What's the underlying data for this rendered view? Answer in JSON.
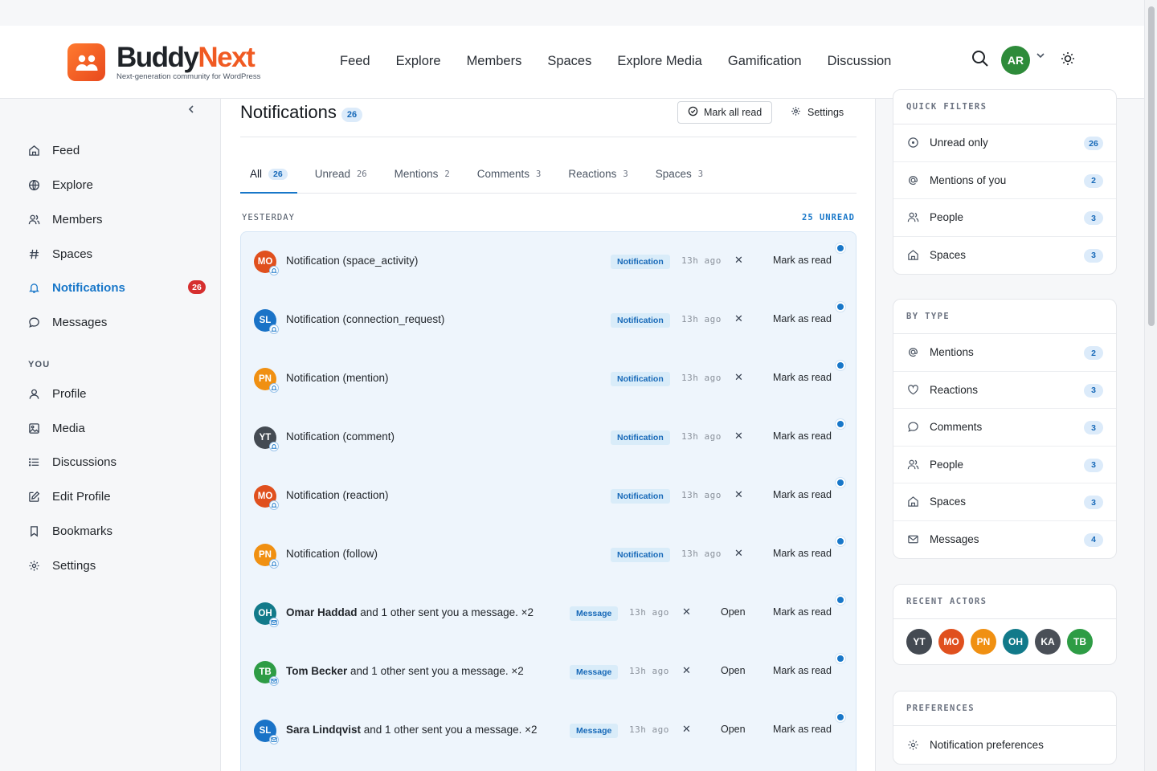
{
  "brand": {
    "name_part1": "Buddy",
    "name_part2": "Next",
    "tagline": "Next-generation community for WordPress"
  },
  "topnav": [
    "Feed",
    "Explore",
    "Members",
    "Spaces",
    "Explore Media",
    "Gamification",
    "Discussion"
  ],
  "user": {
    "initials": "AR"
  },
  "sidebar": {
    "main": [
      {
        "label": "Feed",
        "icon": "home-icon"
      },
      {
        "label": "Explore",
        "icon": "globe-icon"
      },
      {
        "label": "Members",
        "icon": "users-icon"
      },
      {
        "label": "Spaces",
        "icon": "hash-icon"
      },
      {
        "label": "Notifications",
        "icon": "bell-icon",
        "badge": "26",
        "active": true
      },
      {
        "label": "Messages",
        "icon": "chat-icon"
      }
    ],
    "you_heading": "YOU",
    "you": [
      {
        "label": "Profile",
        "icon": "user-icon"
      },
      {
        "label": "Media",
        "icon": "image-icon"
      },
      {
        "label": "Discussions",
        "icon": "list-icon"
      },
      {
        "label": "Edit Profile",
        "icon": "edit-icon"
      },
      {
        "label": "Bookmarks",
        "icon": "bookmark-icon"
      },
      {
        "label": "Settings",
        "icon": "gear-icon"
      }
    ]
  },
  "page": {
    "title": "Notifications",
    "count": "26",
    "mark_all_label": "Mark all read",
    "settings_label": "Settings",
    "tabs": [
      {
        "label": "All",
        "count": "26",
        "active": true
      },
      {
        "label": "Unread",
        "count": "26"
      },
      {
        "label": "Mentions",
        "count": "2"
      },
      {
        "label": "Comments",
        "count": "3"
      },
      {
        "label": "Reactions",
        "count": "3"
      },
      {
        "label": "Spaces",
        "count": "3"
      }
    ],
    "group_label": "YESTERDAY",
    "group_unread": "25 UNREAD",
    "colors": {
      "accent": "#1877c9",
      "badge_red": "#d62f2f"
    }
  },
  "notifications": [
    {
      "initials": "MO",
      "color": "#e0501e",
      "actor": "",
      "text": "Notification (space_activity)",
      "type": "Notification",
      "time": "13h ago",
      "open": "",
      "mark": "Mark as read",
      "mini": "bell"
    },
    {
      "initials": "SL",
      "color": "#1a73c7",
      "actor": "",
      "text": "Notification (connection_request)",
      "type": "Notification",
      "time": "13h ago",
      "open": "",
      "mark": "Mark as read",
      "mini": "bell"
    },
    {
      "initials": "PN",
      "color": "#f09012",
      "actor": "",
      "text": "Notification (mention)",
      "type": "Notification",
      "time": "13h ago",
      "open": "",
      "mark": "Mark as read",
      "mini": "bell"
    },
    {
      "initials": "YT",
      "color": "#444a52",
      "actor": "",
      "text": "Notification (comment)",
      "type": "Notification",
      "time": "13h ago",
      "open": "",
      "mark": "Mark as read",
      "mini": "bell"
    },
    {
      "initials": "MO",
      "color": "#e0501e",
      "actor": "",
      "text": "Notification (reaction)",
      "type": "Notification",
      "time": "13h ago",
      "open": "",
      "mark": "Mark as read",
      "mini": "bell"
    },
    {
      "initials": "PN",
      "color": "#f09012",
      "actor": "",
      "text": "Notification (follow)",
      "type": "Notification",
      "time": "13h ago",
      "open": "",
      "mark": "Mark as read",
      "mini": "bell"
    },
    {
      "initials": "OH",
      "color": "#127a8a",
      "actor": "Omar Haddad",
      "text": " and 1 other sent you a message. ×2",
      "type": "Message",
      "time": "13h ago",
      "open": "Open",
      "mark": "Mark as read",
      "mini": "mail"
    },
    {
      "initials": "TB",
      "color": "#2e9c45",
      "actor": "Tom Becker",
      "text": " and 1 other sent you a message. ×2",
      "type": "Message",
      "time": "13h ago",
      "open": "Open",
      "mark": "Mark as read",
      "mini": "mail"
    },
    {
      "initials": "SL",
      "color": "#1a73c7",
      "actor": "Sara Lindqvist",
      "text": " and 1 other sent you a message. ×2",
      "type": "Message",
      "time": "13h ago",
      "open": "Open",
      "mark": "Mark as read",
      "mini": "mail"
    }
  ],
  "quick_filters": {
    "title": "QUICK FILTERS",
    "items": [
      {
        "label": "Unread only",
        "count": "26",
        "icon": "circle-icon"
      },
      {
        "label": "Mentions of you",
        "count": "2",
        "icon": "at-icon"
      },
      {
        "label": "People",
        "count": "3",
        "icon": "users-icon"
      },
      {
        "label": "Spaces",
        "count": "3",
        "icon": "home-icon"
      }
    ]
  },
  "by_type": {
    "title": "BY TYPE",
    "items": [
      {
        "label": "Mentions",
        "count": "2",
        "icon": "at-icon"
      },
      {
        "label": "Reactions",
        "count": "3",
        "icon": "heart-icon"
      },
      {
        "label": "Comments",
        "count": "3",
        "icon": "chat-icon"
      },
      {
        "label": "People",
        "count": "3",
        "icon": "users-icon"
      },
      {
        "label": "Spaces",
        "count": "3",
        "icon": "home-icon"
      },
      {
        "label": "Messages",
        "count": "4",
        "icon": "mail-icon"
      }
    ]
  },
  "recent_actors": {
    "title": "RECENT ACTORS",
    "items": [
      {
        "initials": "YT",
        "color": "#444a52"
      },
      {
        "initials": "MO",
        "color": "#e0501e"
      },
      {
        "initials": "PN",
        "color": "#f09012"
      },
      {
        "initials": "OH",
        "color": "#127a8a"
      },
      {
        "initials": "KA",
        "color": "#4a4f57"
      },
      {
        "initials": "TB",
        "color": "#2e9c45"
      }
    ]
  },
  "preferences": {
    "title": "PREFERENCES",
    "items": [
      {
        "label": "Notification preferences",
        "icon": "gear-icon"
      }
    ]
  }
}
